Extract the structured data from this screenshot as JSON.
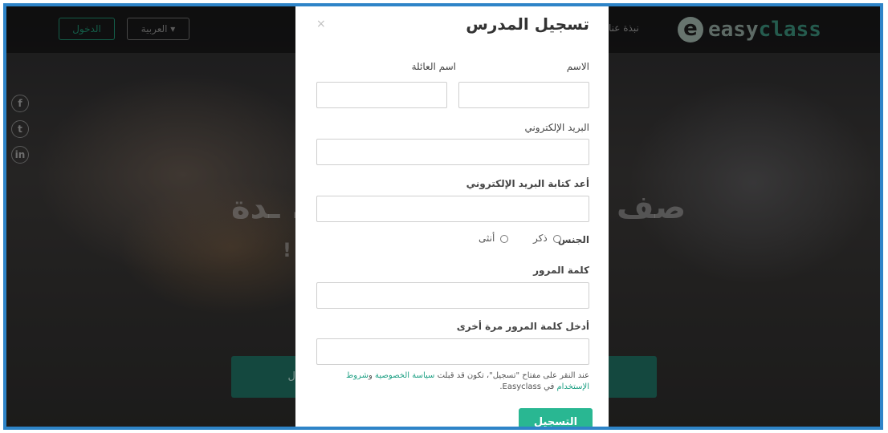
{
  "navbar": {
    "login_label": "الدخول",
    "language_label": "العربية ▾",
    "about_link": "نبذة عنا",
    "logo_easy": "easy",
    "logo_class": "class",
    "logo_letter": "e"
  },
  "social": [
    "f",
    "t",
    "in"
  ],
  "hero": {
    "headline_left": "ـدة ...",
    "headline_right": "صف",
    "exclamation": "!",
    "cta_left_fragment": "ل"
  },
  "modal": {
    "title": "تسجيل المدرس",
    "close": "×",
    "first_name_label": "الاسم",
    "last_name_label": "اسم العائلة",
    "email_label": "البريد الإلكتروني",
    "email_confirm_label": "أعد كتابة البريد الإلكتروني",
    "gender_label": "الجنس",
    "gender_male": "ذكر",
    "gender_female": "أنثى",
    "password_label": "كلمة المرور",
    "password_confirm_label": "أدخل كلمة المرور مرة أخرى",
    "terms_prefix": "عند النقر على مفتاح \"تسجيل\"، تكون قد قبلت",
    "terms_privacy": "سياسة الخصوصية",
    "terms_and": "و",
    "terms_conditions": "شروط الإستخدام",
    "terms_suffix": "في Easyclass.",
    "submit_label": "التسجيل"
  },
  "colors": {
    "accent": "#29b792",
    "frame_border": "#2e84c8",
    "link": "#1ea084"
  }
}
